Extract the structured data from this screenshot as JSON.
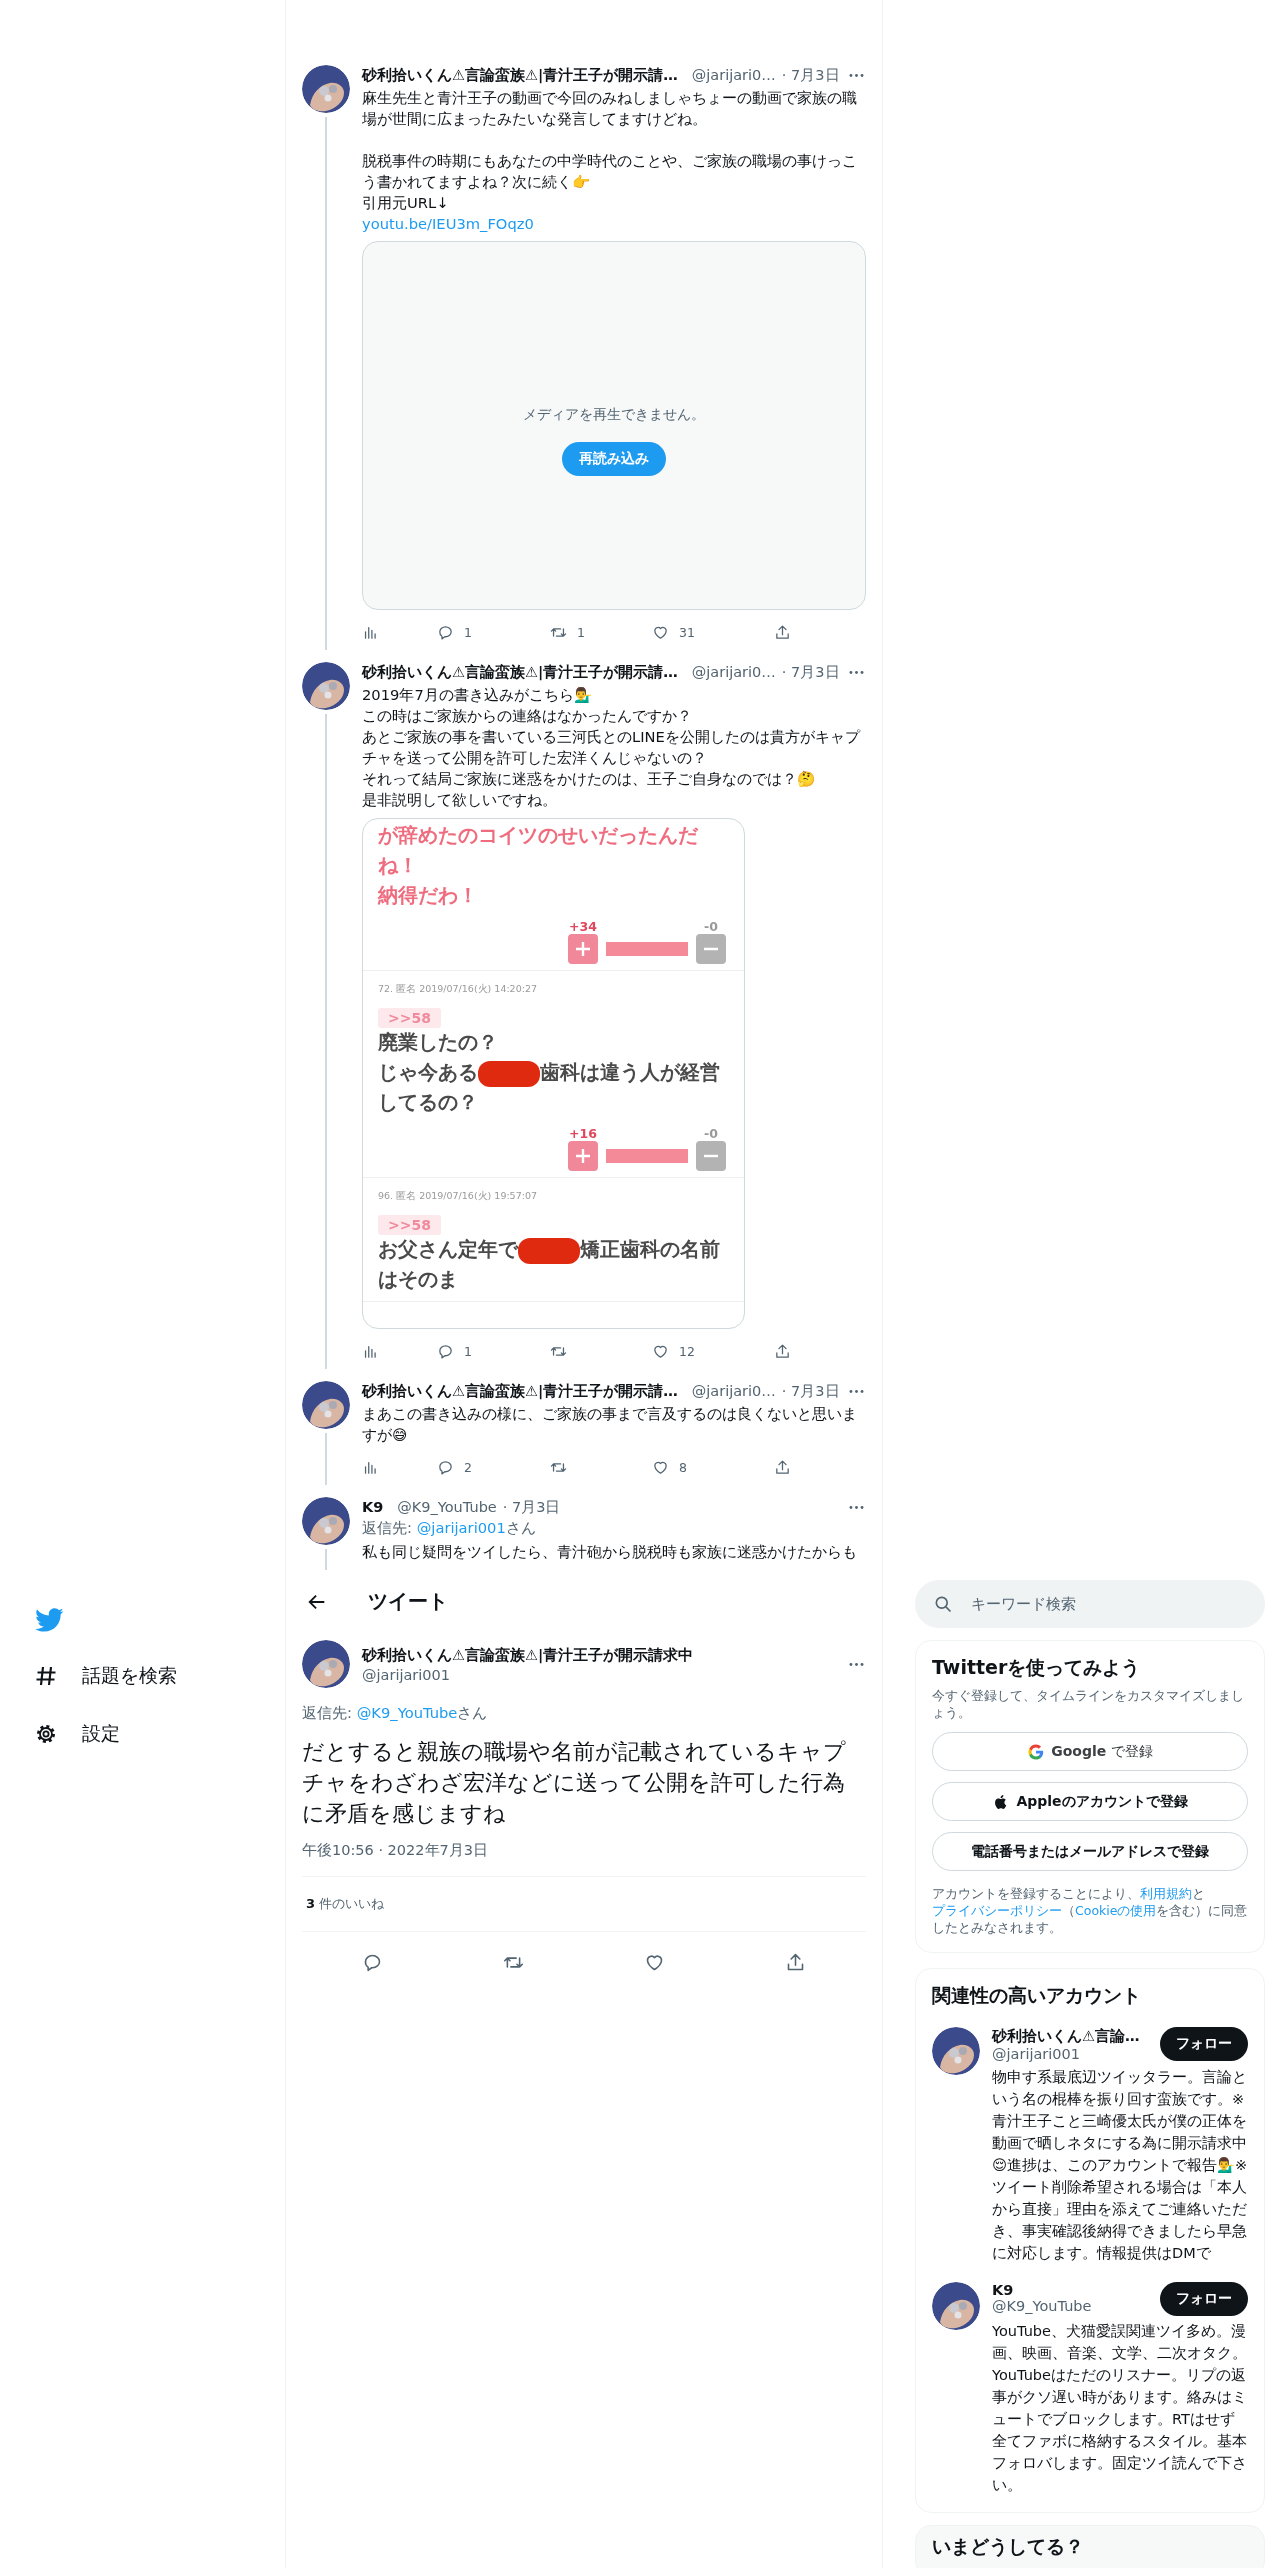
{
  "thread": {
    "tweets": [
      {
        "author": {
          "name": "砂利拾いくん⚠言論蛮族⚠|青汁王子が開示請…",
          "handle": "@jarijari0…"
        },
        "date": "· 7月3日",
        "paragraphs": [
          [
            "麻生先生と青汁王子の動画で今回のみねしましゃちょーの動画で家族の職場が世間に広まったみたいな発言してますけどね。"
          ],
          [
            "脱税事件の時期にもあなたの中学時代のことや、ご家族の職場の事けっこう書かれてますよね？次に続く👉",
            "引用元URL↓"
          ]
        ],
        "link": "youtu.be/IEU3m_FOqz0",
        "media": {
          "kind": "media-error",
          "message": "メディアを再生できません。",
          "button": "再読み込み"
        },
        "actions": {
          "replies": "1",
          "retweets": "1",
          "likes": "31"
        }
      },
      {
        "author": {
          "name": "砂利拾いくん⚠言論蛮族⚠|青汁王子が開示請…",
          "handle": "@jarijari0…"
        },
        "date": "· 7月3日",
        "paragraphs": [
          [
            "2019年7月の書き込みがこちら💁‍♂️",
            "この時はご家族からの連絡はなかったんですか？",
            "あとご家族の事を書いている三河氏とのLINEを公開したのは貴方がキャプチャを送って公開を許可した宏洋くんじゃないの？",
            "それって結局ご家族に迷惑をかけたのは、王子ご自身なのでは？🤔",
            "是非説明して欲しいですね。"
          ]
        ],
        "media": {
          "kind": "forum-screenshot",
          "posts": [
            {
              "highlighted": true,
              "lines": [
                [
                  {
                    "text": "が辞めたのコイツのせいだったんだね！"
                  }
                ],
                [
                  {
                    "text": "納得だわ！"
                  }
                ]
              ],
              "plus": "+34",
              "minus": "-0",
              "level": 1
            },
            {
              "highlighted": false,
              "meta": "72. 匿名 2019/07/16(火) 14:20:27",
              "anchor": ">>58",
              "lines": [
                [
                  {
                    "text": "廃業したの？"
                  }
                ],
                [
                  {
                    "text": "じゃ今ある"
                  },
                  {
                    "kind": "redaction"
                  },
                  {
                    "text": "歯科は違う人が経営してるの？"
                  }
                ]
              ],
              "plus": "+16",
              "minus": "-0",
              "level": 1
            },
            {
              "highlighted": false,
              "meta": "96. 匿名 2019/07/16(火) 19:57:07",
              "anchor": ">>58",
              "lines": [
                [
                  {
                    "text": "お父さん定年で"
                  },
                  {
                    "kind": "redaction"
                  },
                  {
                    "text": "矯正歯科の名前はそのま"
                  }
                ]
              ]
            }
          ]
        },
        "actions": {
          "replies": "1",
          "likes": "12"
        }
      },
      {
        "author": {
          "name": "砂利拾いくん⚠言論蛮族⚠|青汁王子が開示請…",
          "handle": "@jarijari0…"
        },
        "date": "· 7月3日",
        "paragraphs": [
          [
            "まあこの書き込みの様に、ご家族の事まで言及するのは良くないと思いますが😅"
          ]
        ],
        "actions": {
          "replies": "2",
          "likes": "8"
        }
      },
      {
        "author": {
          "name": "K9",
          "handle": "@K9_YouTube"
        },
        "date": "· 7月3日",
        "reply_to": {
          "prefix": "返信先:",
          "handle": "@jarijari001",
          "suffix": "さん"
        },
        "paragraphs": [
          [
            "私も同じ疑問をツイしたら、青汁砲から脱税時も家族に迷惑かけたからも"
          ]
        ]
      }
    ]
  },
  "nav": {
    "items": [
      {
        "kind": "explore",
        "label": "話題を検索"
      },
      {
        "kind": "settings",
        "label": "設定"
      }
    ]
  },
  "detail": {
    "header": {
      "title": "ツイート"
    },
    "tweet": {
      "author": {
        "name": "砂利拾いくん⚠言論蛮族⚠|青汁王子が開示請求中",
        "handle": "@jarijari001"
      },
      "reply_to": {
        "prefix": "返信先:",
        "handle": "@K9_YouTube",
        "suffix": "さん"
      },
      "text": "だとすると親族の職場や名前が記載されているキャプチャをわざわざ宏洋などに送って公開を許可した行為に矛盾を感じますね",
      "timestamp": "午後10:56 · 2022年7月3日",
      "likes": {
        "count": "3",
        "label": "件のいいね"
      }
    }
  },
  "sidebar": {
    "search": {
      "placeholder": "キーワード検索"
    },
    "signup": {
      "title": "Twitterを使ってみよう",
      "subtitle": "今すぐ登録して、タイムラインをカスタマイズしましょう。",
      "buttons": [
        {
          "kind": "google",
          "label": "**Google** で登録"
        },
        {
          "kind": "apple",
          "label": "Appleのアカウントで登録"
        },
        {
          "kind": "phone",
          "label": "電話番号またはメールアドレスで登録"
        }
      ],
      "legal": [
        {
          "text": "アカウントを登録することにより、"
        },
        {
          "link": "利用規約"
        },
        {
          "text": "と"
        },
        {
          "link": "プライバシーポリシー"
        },
        {
          "text": "（"
        },
        {
          "link": "Cookieの使用"
        },
        {
          "text": "を含む）に同意したとみなされます。"
        }
      ]
    },
    "related": {
      "title": "関連性の高いアカウント",
      "accounts": [
        {
          "name": "砂利拾いくん⚠言論…",
          "handle": "@jarijari001",
          "follow": "フォロー",
          "bio": "物申す系最底辺ツイッタラー。言論という名の棍棒を振り回す蛮族です。※青汁王子こと三崎優太氏が僕の正体を動画で晒しネタにする為に開示請求中😌進捗は、このアカウントで報告💁‍♂️※ツイート削除希望される場合は「本人から直接」理由を添えてご連絡いただき、事実確認後納得できましたら早急に対応します。情報提供はDMで"
        },
        {
          "name": "K9",
          "handle": "@K9_YouTube",
          "follow": "フォロー",
          "bio": "YouTube、犬猫愛誤関連ツイ多め。漫画、映画、音楽、文学、二次オタク。YouTubeはただのリスナー。リプの返事がクソ遅い時があります。絡みはミュートでブロックします。RTはせず全てファボに格納するスタイル。基本フォロバします。固定ツイ読んで下さい。"
        }
      ]
    },
    "trends": {
      "title": "いまどうしてる？"
    }
  }
}
